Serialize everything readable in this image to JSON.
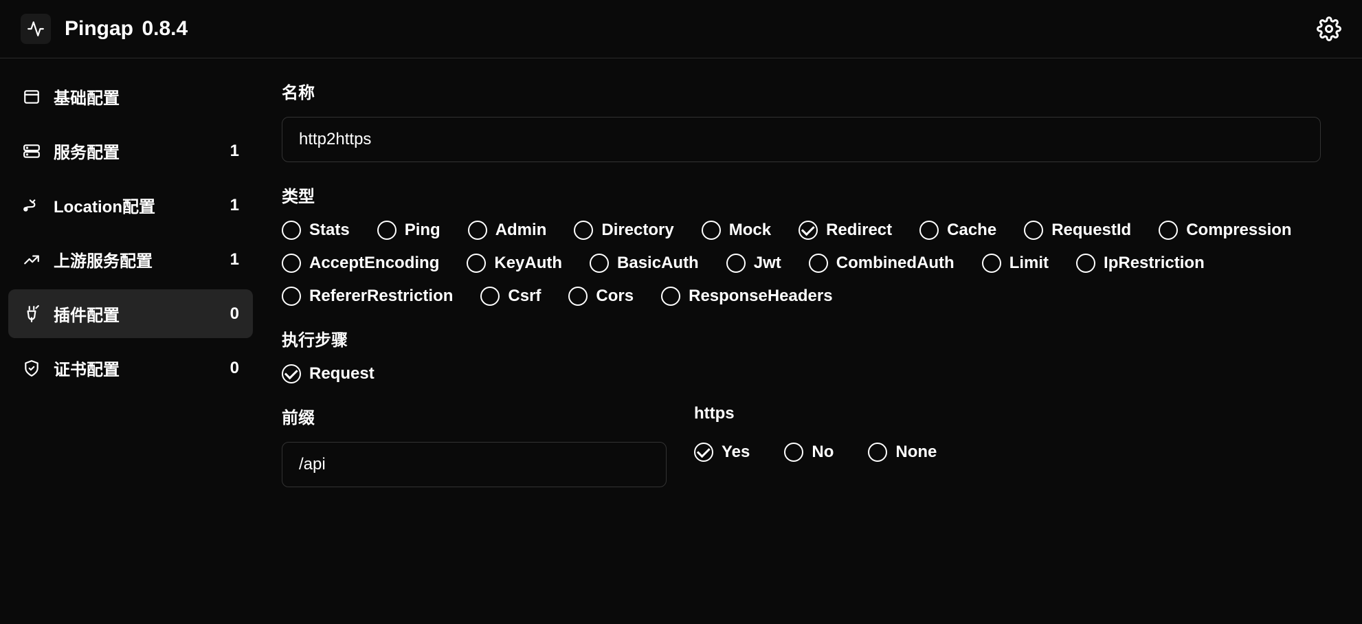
{
  "header": {
    "app_name": "Pingap",
    "version": "0.8.4"
  },
  "sidebar": {
    "items": [
      {
        "icon": "window",
        "label": "基础配置",
        "count": ""
      },
      {
        "icon": "server",
        "label": "服务配置",
        "count": "1"
      },
      {
        "icon": "route",
        "label": "Location配置",
        "count": "1"
      },
      {
        "icon": "trend",
        "label": "上游服务配置",
        "count": "1"
      },
      {
        "icon": "plug",
        "label": "插件配置",
        "count": "0"
      },
      {
        "icon": "shield",
        "label": "证书配置",
        "count": "0"
      }
    ]
  },
  "form": {
    "name_label": "名称",
    "name_value": "http2https",
    "type_label": "类型",
    "type_options": [
      {
        "label": "Stats",
        "checked": false
      },
      {
        "label": "Ping",
        "checked": false
      },
      {
        "label": "Admin",
        "checked": false
      },
      {
        "label": "Directory",
        "checked": false
      },
      {
        "label": "Mock",
        "checked": false
      },
      {
        "label": "Redirect",
        "checked": true
      },
      {
        "label": "Cache",
        "checked": false
      },
      {
        "label": "RequestId",
        "checked": false
      },
      {
        "label": "Compression",
        "checked": false
      },
      {
        "label": "AcceptEncoding",
        "checked": false
      },
      {
        "label": "KeyAuth",
        "checked": false
      },
      {
        "label": "BasicAuth",
        "checked": false
      },
      {
        "label": "Jwt",
        "checked": false
      },
      {
        "label": "CombinedAuth",
        "checked": false
      },
      {
        "label": "Limit",
        "checked": false
      },
      {
        "label": "IpRestriction",
        "checked": false
      },
      {
        "label": "RefererRestriction",
        "checked": false
      },
      {
        "label": "Csrf",
        "checked": false
      },
      {
        "label": "Cors",
        "checked": false
      },
      {
        "label": "ResponseHeaders",
        "checked": false
      }
    ],
    "step_label": "执行步骤",
    "step_options": [
      {
        "label": "Request",
        "checked": true
      }
    ],
    "prefix_label": "前缀",
    "prefix_value": "/api",
    "https_label": "https",
    "https_options": [
      {
        "label": "Yes",
        "checked": true
      },
      {
        "label": "No",
        "checked": false
      },
      {
        "label": "None",
        "checked": false
      }
    ]
  }
}
